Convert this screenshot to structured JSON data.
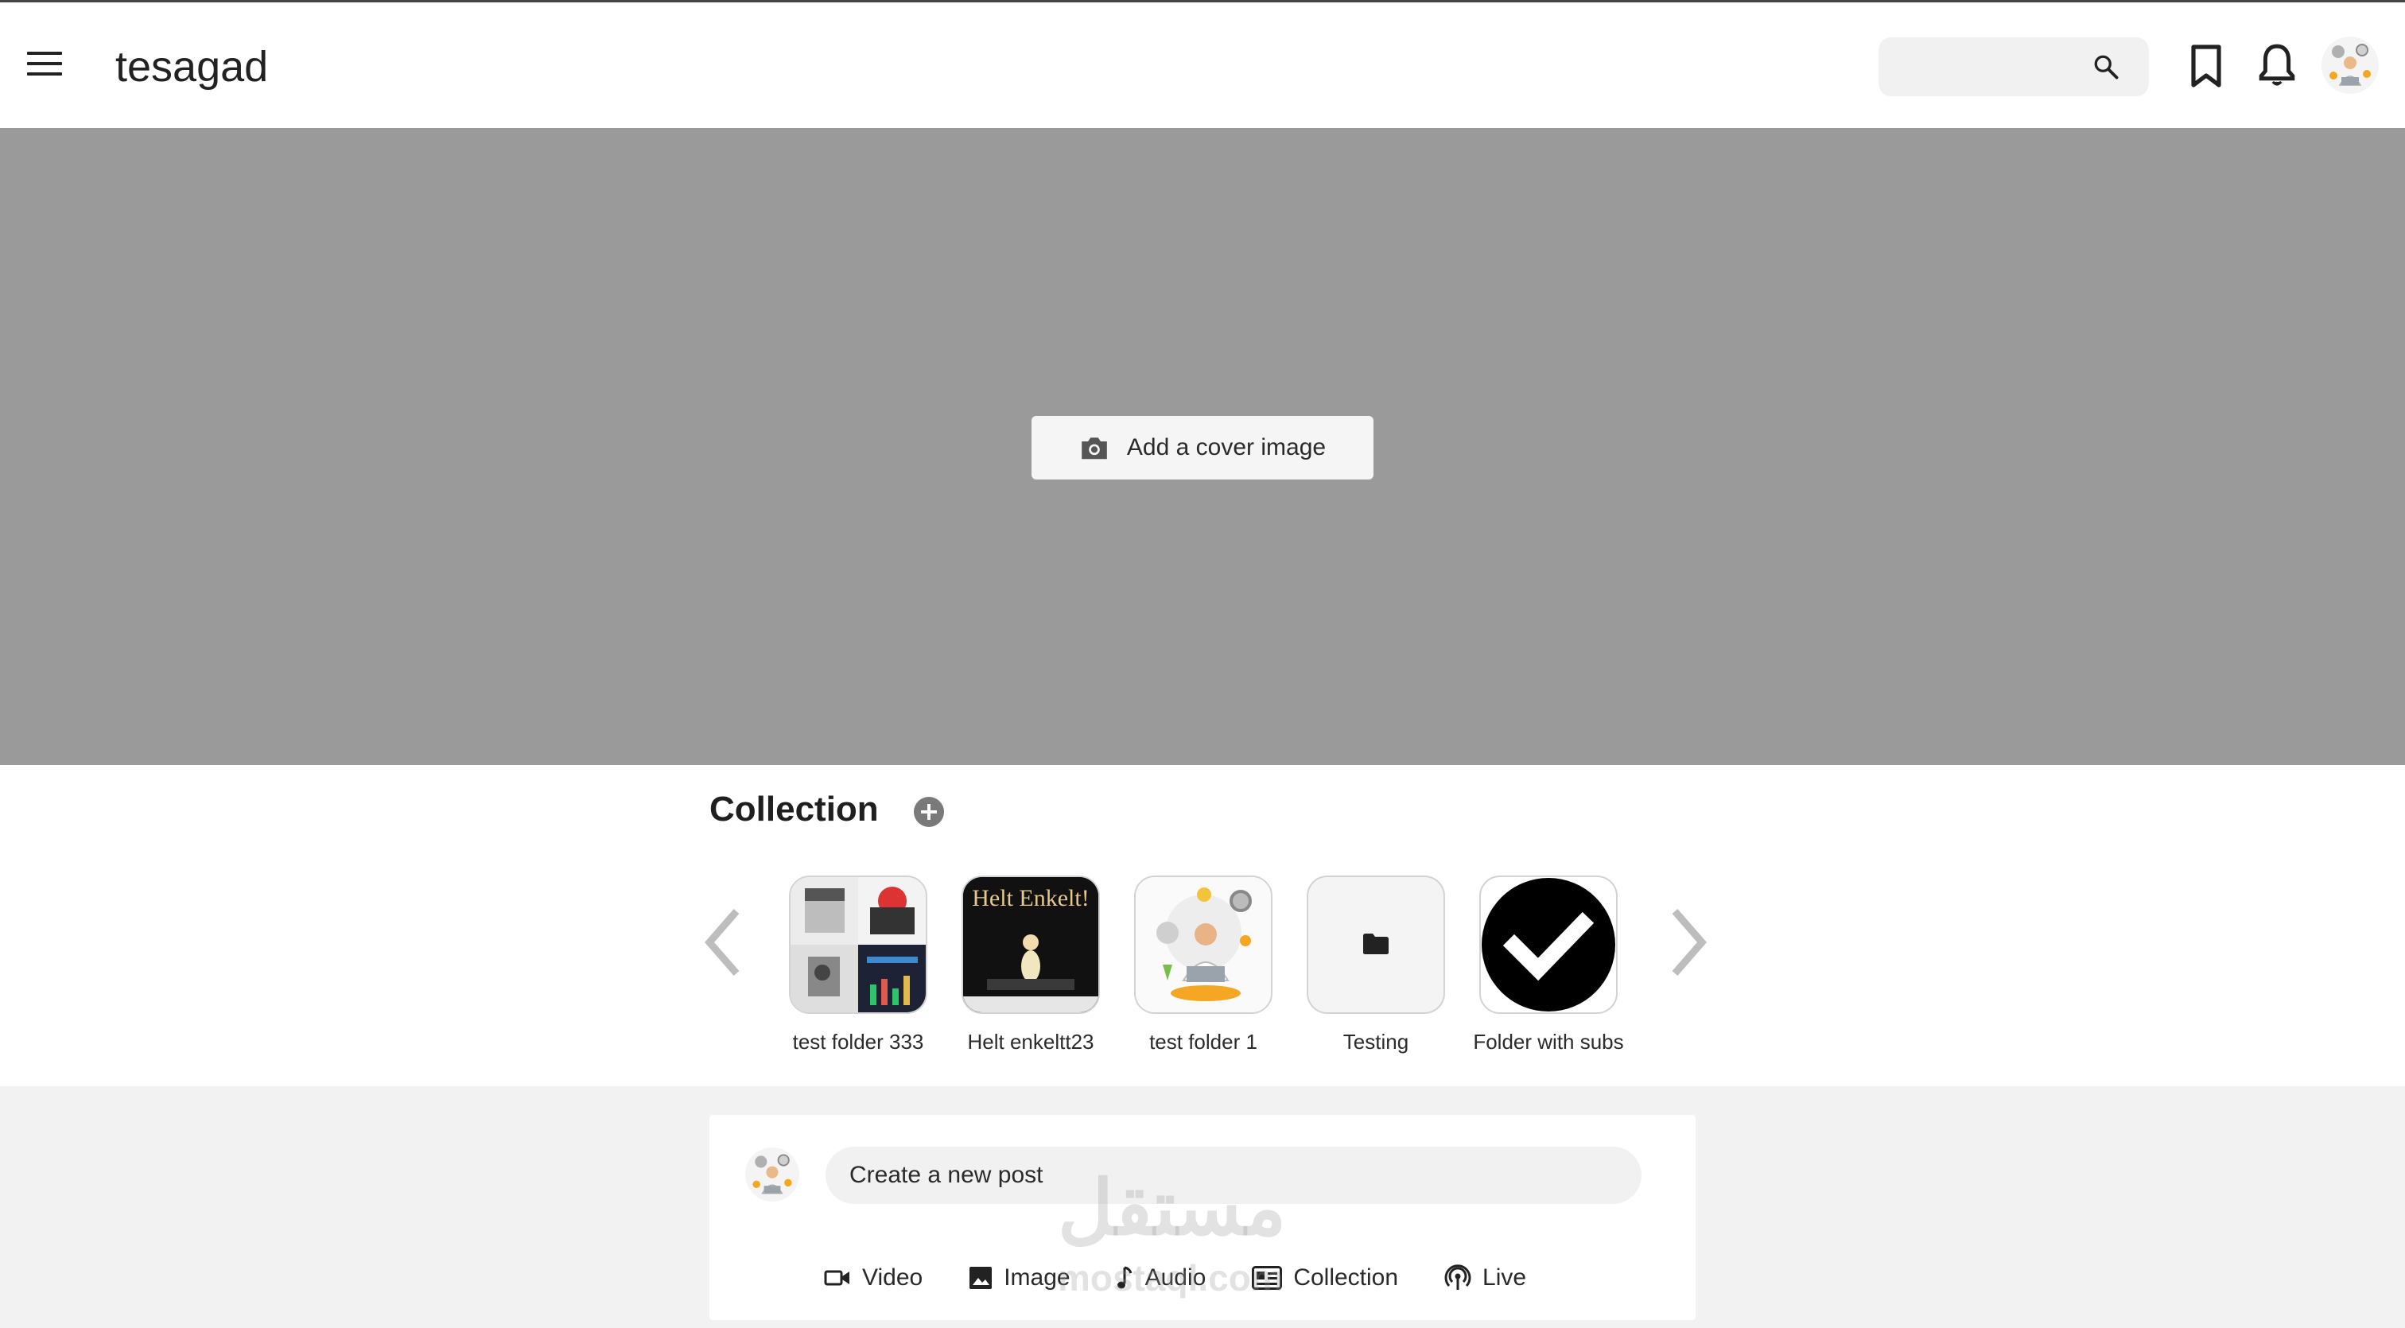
{
  "header": {
    "title": "tesagad",
    "search_placeholder": ""
  },
  "cover": {
    "button_label": "Add a cover image"
  },
  "collection": {
    "title": "Collection",
    "items": [
      {
        "label": "test folder 333",
        "kind": "image-collage"
      },
      {
        "label": "Helt enkeltt23",
        "kind": "album-cover",
        "cover_text": "Helt Enkelt!"
      },
      {
        "label": "test folder 1",
        "kind": "illustration"
      },
      {
        "label": "Testing",
        "kind": "folder-icon"
      },
      {
        "label": "Folder with subs",
        "kind": "check-icon"
      }
    ]
  },
  "composer": {
    "placeholder": "Create a new post",
    "actions": [
      {
        "label": "Video",
        "icon": "video-icon"
      },
      {
        "label": "Image",
        "icon": "image-icon"
      },
      {
        "label": "Audio",
        "icon": "music-note-icon"
      },
      {
        "label": "Collection",
        "icon": "collection-icon"
      },
      {
        "label": "Live",
        "icon": "broadcast-icon"
      }
    ]
  },
  "watermark": {
    "text": "مستقل",
    "subtext": "mostaql.com"
  },
  "colors": {
    "cover_bg": "#9a9a9a",
    "post_area_bg": "#f2f2f2",
    "accent": "#1f1f1f"
  }
}
